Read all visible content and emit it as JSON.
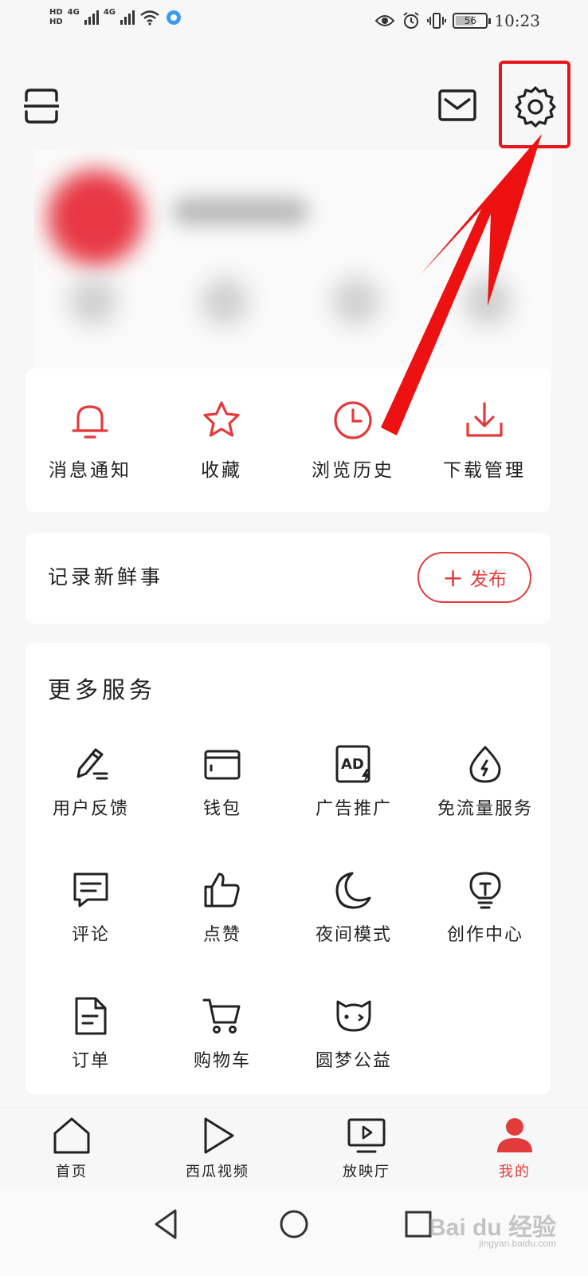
{
  "status_bar": {
    "time": "10:23",
    "battery": "56",
    "network_1": "4G",
    "network_2": "4G",
    "hd_1": "HD",
    "hd_2": "HD"
  },
  "header": {
    "scan_icon": "scan-icon",
    "mail_icon": "mail-icon",
    "settings_icon": "gear-icon"
  },
  "quick_actions": [
    {
      "label": "消息通知",
      "icon": "bell-icon"
    },
    {
      "label": "收藏",
      "icon": "star-icon"
    },
    {
      "label": "浏览历史",
      "icon": "clock-icon"
    },
    {
      "label": "下载管理",
      "icon": "download-icon"
    }
  ],
  "post": {
    "label": "记录新鲜事",
    "publish_label": "发布"
  },
  "services": {
    "title": "更多服务",
    "items": [
      {
        "label": "用户反馈",
        "icon": "pen-icon"
      },
      {
        "label": "钱包",
        "icon": "wallet-icon"
      },
      {
        "label": "广告推广",
        "icon": "ad-icon"
      },
      {
        "label": "免流量服务",
        "icon": "data-drop-icon"
      },
      {
        "label": "评论",
        "icon": "comment-icon"
      },
      {
        "label": "点赞",
        "icon": "thumbs-up-icon"
      },
      {
        "label": "夜间模式",
        "icon": "moon-icon"
      },
      {
        "label": "创作中心",
        "icon": "lightbulb-icon"
      },
      {
        "label": "订单",
        "icon": "document-icon"
      },
      {
        "label": "购物车",
        "icon": "cart-icon"
      },
      {
        "label": "圆梦公益",
        "icon": "cat-face-icon"
      }
    ]
  },
  "bottom_nav": [
    {
      "label": "首页",
      "icon": "home-icon",
      "active": false
    },
    {
      "label": "西瓜视频",
      "icon": "play-icon",
      "active": false
    },
    {
      "label": "放映厅",
      "icon": "tv-play-icon",
      "active": false
    },
    {
      "label": "我的",
      "icon": "person-icon",
      "active": true
    }
  ],
  "watermark": {
    "text": "Bai du 经验",
    "sub": "jingyan.baidu.com"
  },
  "colors": {
    "accent": "#e23b3b",
    "highlight": "#e8141a",
    "background": "#f7f7f7"
  }
}
